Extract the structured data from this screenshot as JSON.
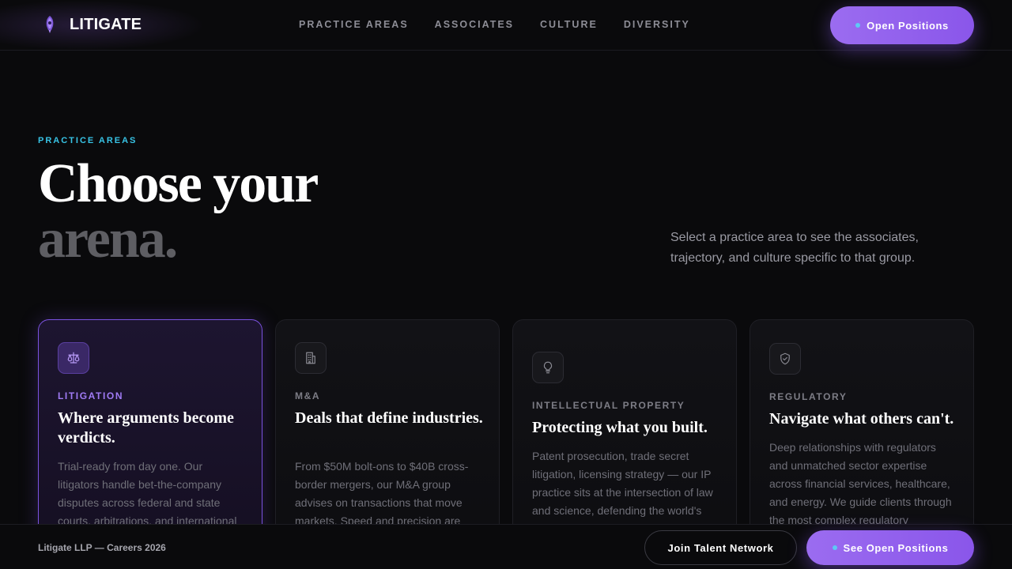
{
  "brand": {
    "name": "LITIGATE"
  },
  "nav": {
    "items": [
      "PRACTICE AREAS",
      "ASSOCIATES",
      "CULTURE",
      "DIVERSITY"
    ]
  },
  "header": {
    "cta_label": "Open Positions"
  },
  "hero": {
    "eyebrow": "PRACTICE AREAS",
    "title_line1": "Choose your",
    "title_line2": "arena.",
    "description": "Select a practice area to see the associates, trajectory, and culture specific to that group."
  },
  "cards": [
    {
      "icon": "scales-icon",
      "eyebrow": "LITIGATION",
      "title": "Where arguments become verdicts.",
      "body": "Trial-ready from day one. Our litigators handle bet-the-company disputes across federal and state courts, arbitrations, and international",
      "active": true
    },
    {
      "icon": "building-icon",
      "eyebrow": "M&A",
      "title": "Deals that define industries.",
      "body": "From $50M bolt-ons to $40B cross-border mergers, our M&A group advises on transactions that move markets. Speed and precision are",
      "active": false
    },
    {
      "icon": "lightbulb-icon",
      "eyebrow": "INTELLECTUAL PROPERTY",
      "title": "Protecting what you built.",
      "body": "Patent prosecution, trade secret litigation, licensing strategy — our IP practice sits at the intersection of law and science, defending the world's",
      "active": false
    },
    {
      "icon": "shield-check-icon",
      "eyebrow": "REGULATORY",
      "title": "Navigate what others can't.",
      "body": "Deep relationships with regulators and unmatched sector expertise across financial services, healthcare, and energy. We guide clients through the most complex regulatory",
      "active": false
    }
  ],
  "footer": {
    "note": "Litigate LLP — Careers 2026",
    "secondary_label": "Join Talent Network",
    "primary_label": "See Open Positions"
  },
  "colors": {
    "accent": "#8b5cf6",
    "accent_cyan": "#38c4e6",
    "background": "#0a0a0c"
  }
}
